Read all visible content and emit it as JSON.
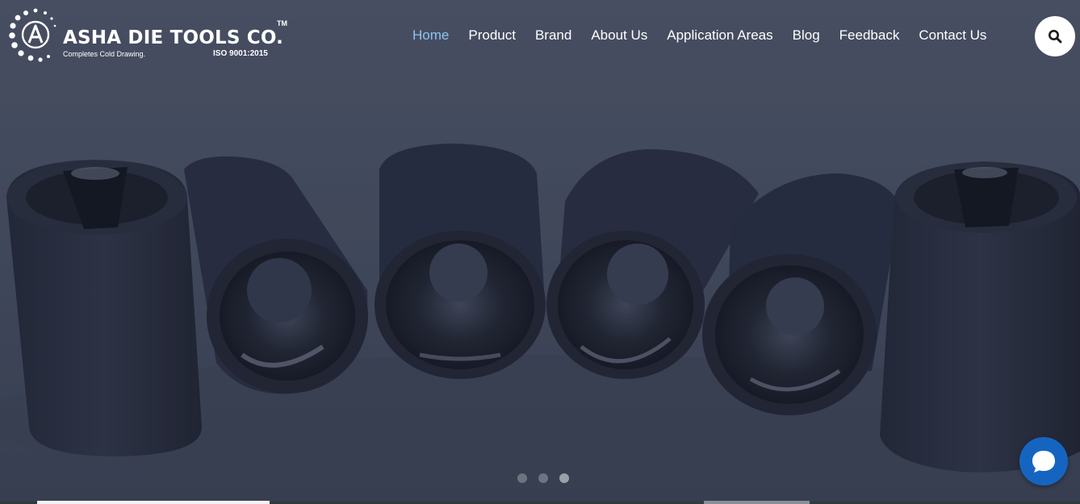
{
  "brand": {
    "name": "ASHA DIE TOOLS CO.",
    "trademark": "TM",
    "tagline": "Completes Cold Drawing.",
    "certification": "ISO 9001:2015"
  },
  "nav": {
    "items": [
      {
        "label": "Home",
        "active": true
      },
      {
        "label": "Product",
        "active": false
      },
      {
        "label": "Brand",
        "active": false
      },
      {
        "label": "About Us",
        "active": false
      },
      {
        "label": "Application Areas",
        "active": false
      },
      {
        "label": "Blog",
        "active": false
      },
      {
        "label": "Feedback",
        "active": false
      },
      {
        "label": "Contact Us",
        "active": false
      }
    ],
    "active_color": "#8ec3f0"
  },
  "search": {
    "icon": "search-icon"
  },
  "slider": {
    "slide_count": 3,
    "active_slide": 3,
    "image_subject": "carbide drawing dies"
  },
  "chat": {
    "icon": "chat-bubble-icon",
    "color": "#1565c0"
  },
  "colors": {
    "overlay": "#434a5c",
    "nav_text": "#ffffff"
  }
}
